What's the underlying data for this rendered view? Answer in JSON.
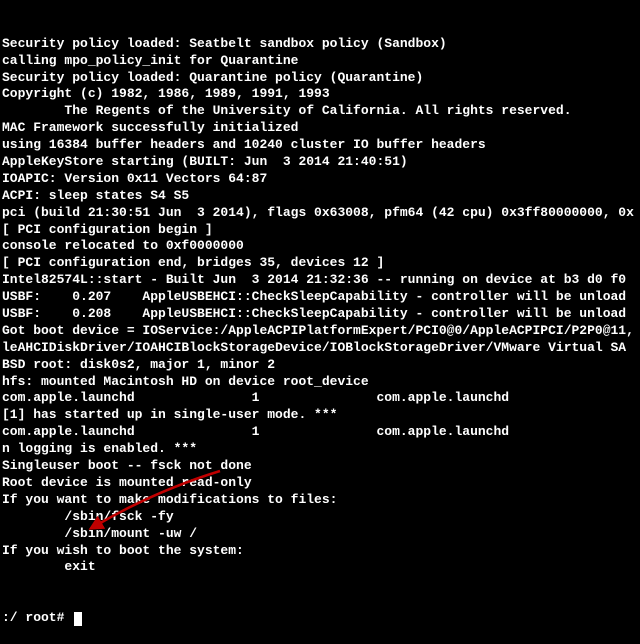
{
  "lines": [
    "Security policy loaded: Seatbelt sandbox policy (Sandbox)",
    "calling mpo_policy_init for Quarantine",
    "Security policy loaded: Quarantine policy (Quarantine)",
    "Copyright (c) 1982, 1986, 1989, 1991, 1993",
    "        The Regents of the University of California. All rights reserved.",
    "",
    "MAC Framework successfully initialized",
    "using 16384 buffer headers and 10240 cluster IO buffer headers",
    "AppleKeyStore starting (BUILT: Jun  3 2014 21:40:51)",
    "IOAPIC: Version 0x11 Vectors 64:87",
    "ACPI: sleep states S4 S5",
    "pci (build 21:30:51 Jun  3 2014), flags 0x63008, pfm64 (42 cpu) 0x3ff80000000, 0x",
    "[ PCI configuration begin ]",
    "console relocated to 0xf0000000",
    "[ PCI configuration end, bridges 35, devices 12 ]",
    "Intel82574L::start - Built Jun  3 2014 21:32:36 -- running on device at b3 d0 f0",
    "USBF:    0.207    AppleUSBEHCI::CheckSleepCapability - controller will be unload",
    "USBF:    0.208    AppleUSBEHCI::CheckSleepCapability - controller will be unload",
    "Got boot device = IOService:/AppleACPIPlatformExpert/PCI0@0/AppleACPIPCI/P2P0@11,",
    "leAHCIDiskDriver/IOAHCIBlockStorageDevice/IOBlockStorageDriver/VMware Virtual SA",
    "BSD root: disk0s2, major 1, minor 2",
    "hfs: mounted Macintosh HD on device root_device",
    "com.apple.launchd               1               com.apple.launchd",
    "[1] has started up in single-user mode. ***",
    "com.apple.launchd               1               com.apple.launchd",
    "n logging is enabled. ***",
    "Singleuser boot -- fsck not done",
    "Root device is mounted read-only",
    "If you want to make modifications to files:",
    "        /sbin/fsck -fy",
    "        /sbin/mount -uw /",
    "If you wish to boot the system:",
    "        exit"
  ],
  "prompt": ":/ root# ",
  "arrow_color": "#c00000"
}
